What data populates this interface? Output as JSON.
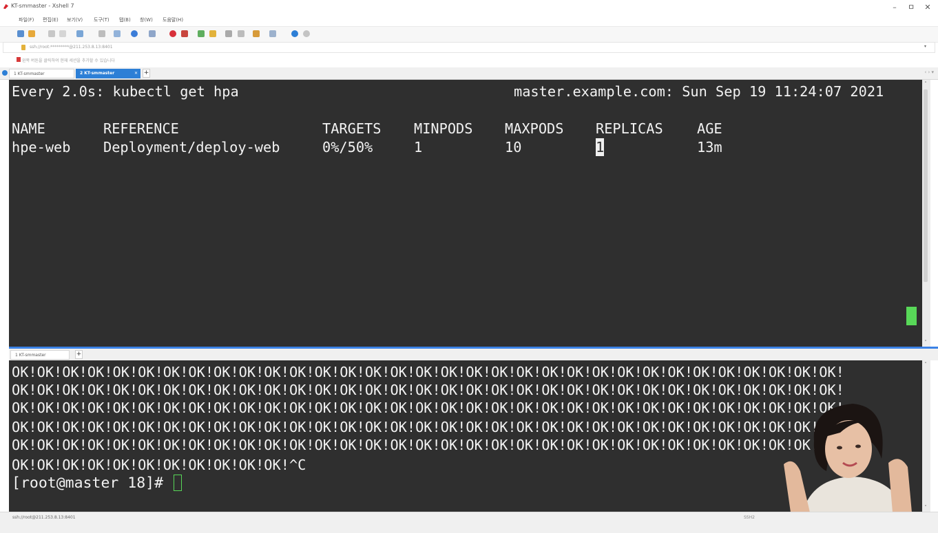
{
  "window": {
    "title": "KT-smmaster - Xshell 7",
    "minimize": "–",
    "maximize": "ㅁ",
    "close": "✕"
  },
  "menu": [
    "파일(F)",
    "편집(E)",
    "보기(V)",
    "도구(T)",
    "탭(B)",
    "창(W)",
    "도움말(H)"
  ],
  "address_bar": {
    "value": "ssh://root:*********@211.253.8.13:8401"
  },
  "hint_bar": {
    "text": "왼쪽 버튼을 클릭하여 현재 세션을 추가할 수 있습니다"
  },
  "tabs": [
    {
      "label": "1 KT-smmaster",
      "active": false
    },
    {
      "label": "2 KT-smmaster",
      "active": true
    }
  ],
  "add_tab": "+",
  "pane_top": {
    "header_command": "Every 2.0s: kubectl get hpa",
    "header_host": "master.example.com: Sun Sep 19 11:24:07 2021",
    "columns": [
      "NAME",
      "REFERENCE",
      "TARGETS",
      "MINPODS",
      "MAXPODS",
      "REPLICAS",
      "AGE"
    ],
    "rows": [
      [
        "hpe-web",
        "Deployment/deploy-web",
        "0%/50%",
        "1",
        "10",
        "1",
        "13m"
      ]
    ]
  },
  "pane_bottom": {
    "tab_label": "1 KT-smmaster",
    "ok_lines": [
      "OK!OK!OK!OK!OK!OK!OK!OK!OK!OK!OK!OK!OK!OK!OK!OK!OK!OK!OK!OK!OK!OK!OK!OK!OK!OK!OK!OK!OK!OK!OK!OK!OK!",
      "OK!OK!OK!OK!OK!OK!OK!OK!OK!OK!OK!OK!OK!OK!OK!OK!OK!OK!OK!OK!OK!OK!OK!OK!OK!OK!OK!OK!OK!OK!OK!OK!OK!",
      "OK!OK!OK!OK!OK!OK!OK!OK!OK!OK!OK!OK!OK!OK!OK!OK!OK!OK!OK!OK!OK!OK!OK!OK!OK!OK!OK!OK!OK!OK!OK!OK!OK!",
      "OK!OK!OK!OK!OK!OK!OK!OK!OK!OK!OK!OK!OK!OK!OK!OK!OK!OK!OK!OK!OK!OK!OK!OK!OK!OK!OK!OK!OK!OK!OK!OK!OK!",
      "OK!OK!OK!OK!OK!OK!OK!OK!OK!OK!OK!OK!OK!OK!OK!OK!OK!OK!OK!OK!OK!OK!OK!OK!OK!OK!OK!OK!OK!OK!OK!OK!OK!",
      "OK!OK!OK!OK!OK!OK!OK!OK!OK!OK!OK!^C"
    ],
    "prompt": "[root@master 18]# "
  },
  "status_bar": {
    "connection": "ssh://root@211.253.8.13:8401",
    "protocol": "SSH2"
  },
  "colors": {
    "terminal_bg": "#2f2f2f",
    "terminal_fg": "#f2f2f2",
    "accent": "#2d7fd6",
    "cursor": "#58d858"
  }
}
